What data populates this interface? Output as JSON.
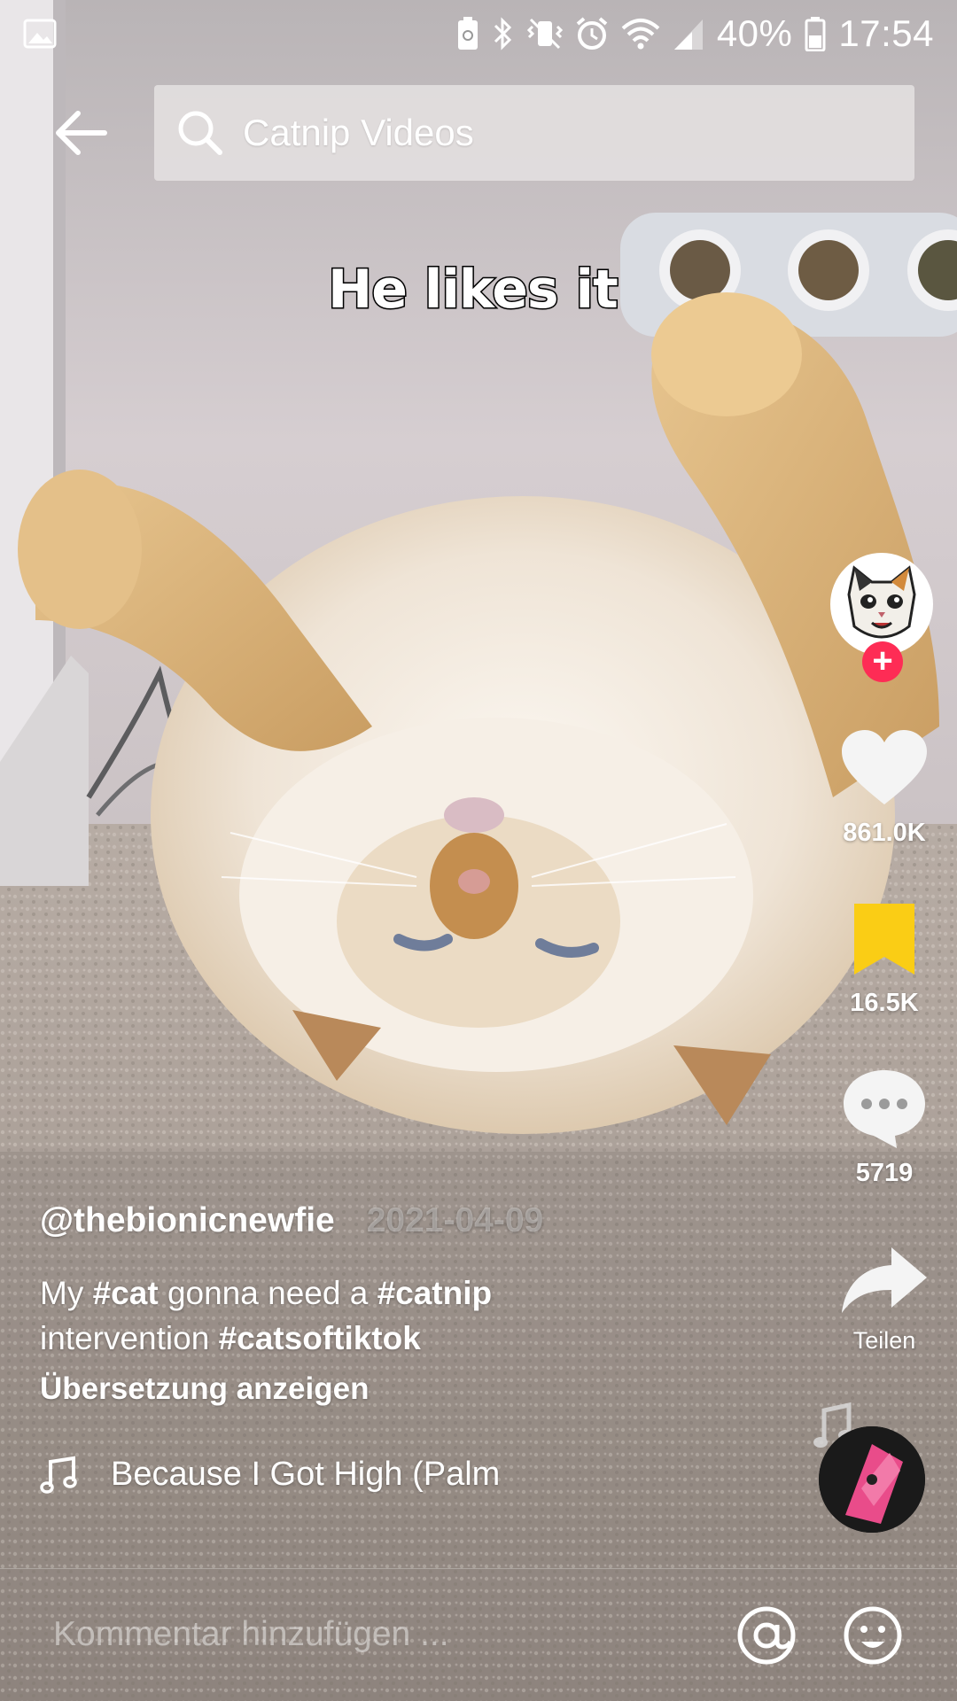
{
  "status_bar": {
    "battery_percent": "40%",
    "time": "17:54",
    "icons": [
      "image-notification-icon",
      "battery-saver-icon",
      "bluetooth-icon",
      "mute-vibrate-icon",
      "alarm-icon",
      "wifi-icon",
      "signal-icon",
      "battery-icon"
    ]
  },
  "search": {
    "query": "Catnip Videos"
  },
  "video": {
    "caption_overlay": "He likes it"
  },
  "post": {
    "username": "@thebionicnewfie",
    "date": "2021-04-09",
    "description": {
      "part1": "My ",
      "tag1": "#cat",
      "part2": " gonna need a ",
      "tag2": "#catnip",
      "part3": " intervention ",
      "tag3": "#catsoftiktok"
    },
    "translate_label": "Übersetzung anzeigen",
    "music_title": "Because I Got High (Palm"
  },
  "actions": {
    "likes": "861.0K",
    "favorites": "16.5K",
    "comments": "5719",
    "share_label": "Teilen"
  },
  "comment_bar": {
    "placeholder": "Kommentar hinzufügen ..."
  },
  "colors": {
    "accent_red": "#fe2c55",
    "favorite_yellow": "#facd15"
  }
}
